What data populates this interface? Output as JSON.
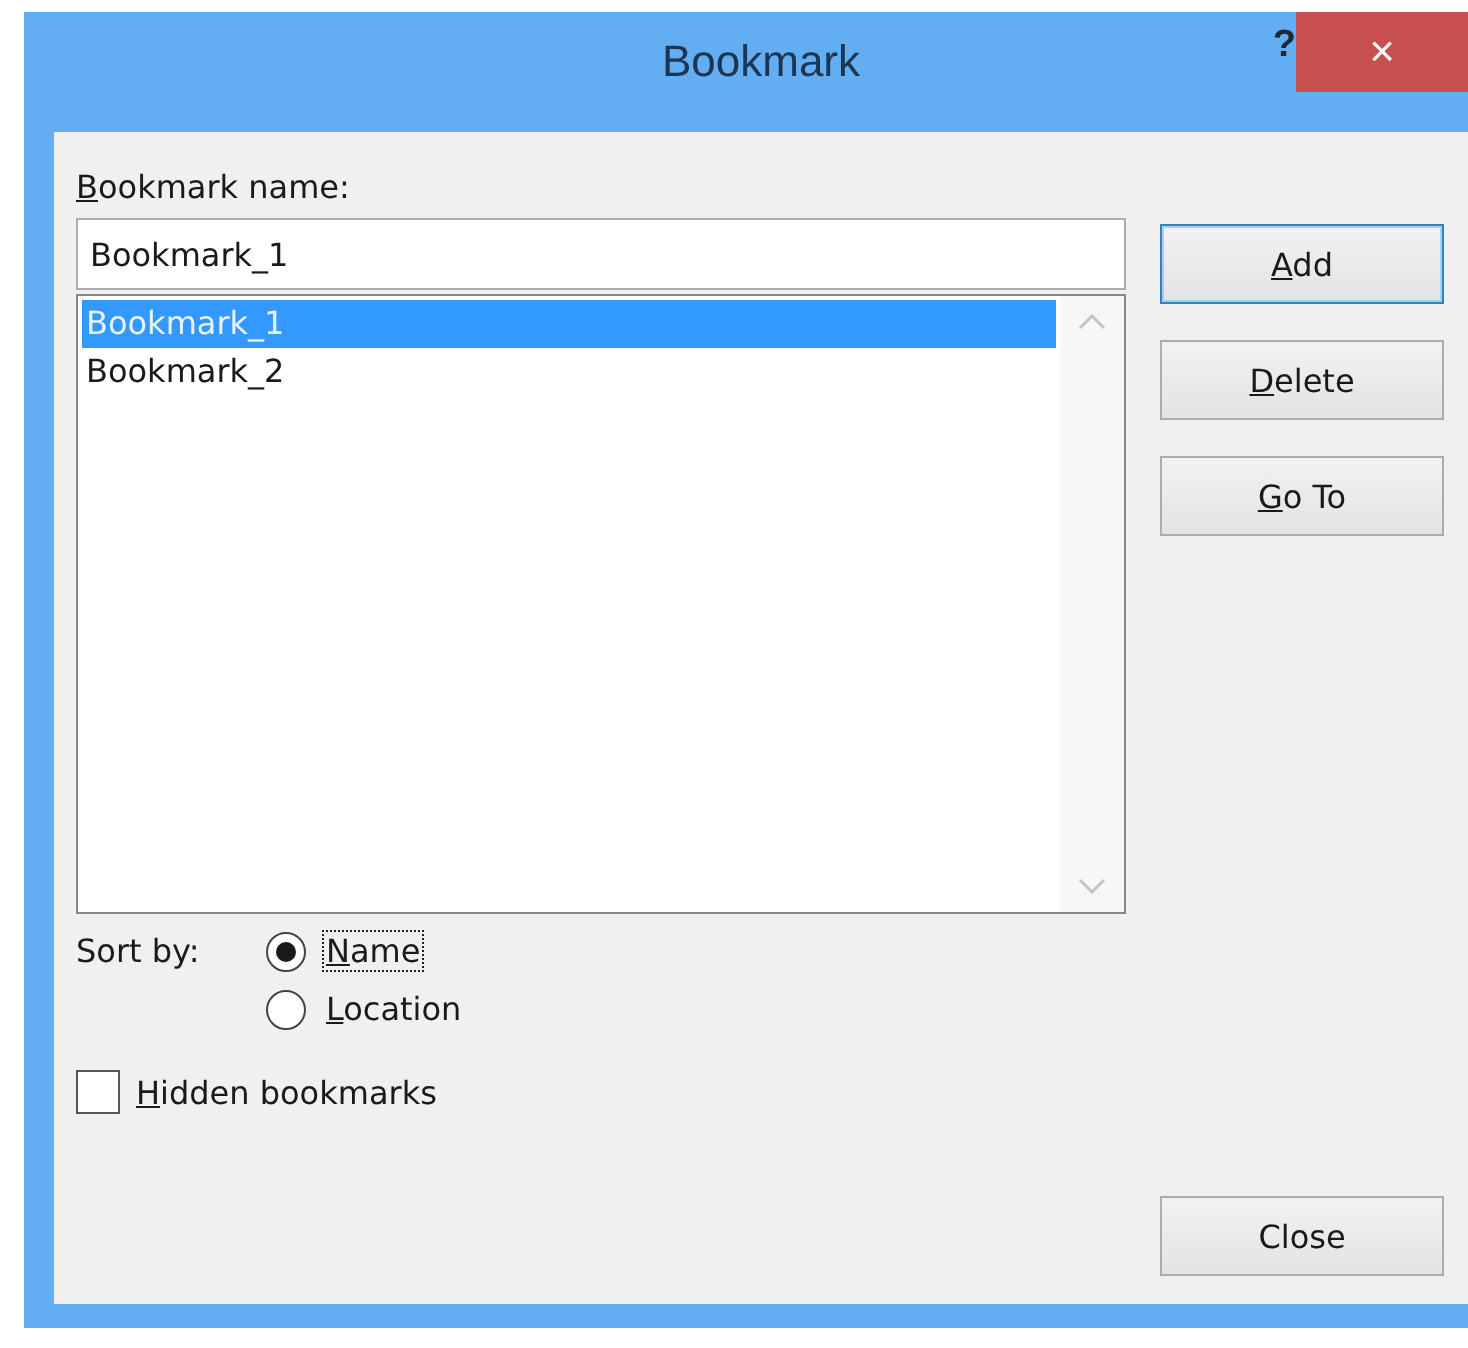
{
  "window": {
    "title": "Bookmark",
    "help": "?",
    "close": "×"
  },
  "name_field": {
    "label": "Bookmark name:",
    "mnemonic": true,
    "value": "Bookmark_1"
  },
  "bookmarks": [
    {
      "label": "Bookmark_1",
      "selected": true
    },
    {
      "label": "Bookmark_2",
      "selected": false
    }
  ],
  "buttons": [
    {
      "label": "Add",
      "mnemonic": true,
      "default": true
    },
    {
      "label": "Delete",
      "mnemonic": true,
      "default": false
    },
    {
      "label": "Go To",
      "mnemonic": true,
      "default": false
    }
  ],
  "sort_by": {
    "label": "Sort by:",
    "options": [
      {
        "label": "Name",
        "mnemonic": true,
        "selected": true,
        "focused": true
      },
      {
        "label": "Location",
        "mnemonic": true,
        "selected": false,
        "focused": false
      }
    ]
  },
  "hidden_bookmarks": {
    "label": "Hidden bookmarks",
    "mnemonic": true,
    "checked": false
  },
  "close_button": {
    "label": "Close",
    "mnemonic": false
  }
}
